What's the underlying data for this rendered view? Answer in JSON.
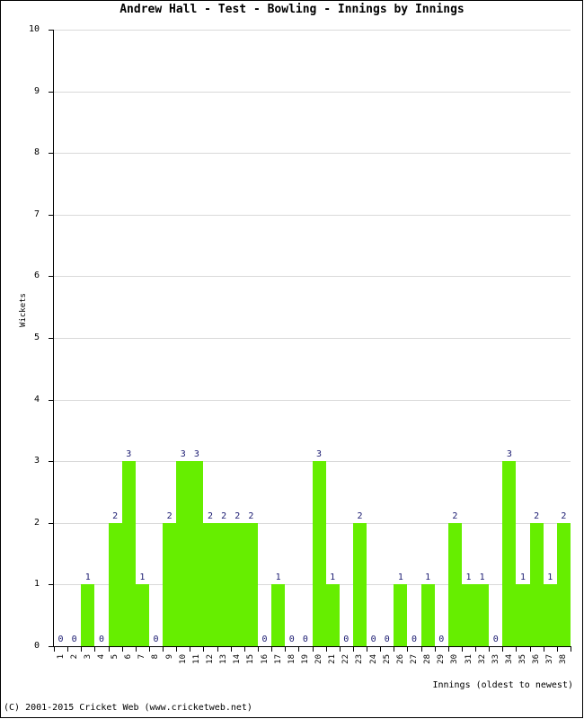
{
  "chart_data": {
    "type": "bar",
    "title": "Andrew Hall - Test - Bowling - Innings by Innings",
    "xlabel": "Innings (oldest to newest)",
    "ylabel": "Wickets",
    "ylim": [
      0,
      10
    ],
    "yticks": [
      0,
      1,
      2,
      3,
      4,
      5,
      6,
      7,
      8,
      9,
      10
    ],
    "grid": true,
    "legend": "none",
    "bar_color": "#66ee00",
    "label_color": "#191970",
    "categories": [
      "1",
      "2",
      "3",
      "4",
      "5",
      "6",
      "7",
      "8",
      "9",
      "10",
      "11",
      "12",
      "13",
      "14",
      "15",
      "16",
      "17",
      "18",
      "19",
      "20",
      "21",
      "22",
      "23",
      "24",
      "25",
      "26",
      "27",
      "28",
      "29",
      "30",
      "31",
      "32",
      "33",
      "34",
      "35",
      "36",
      "37",
      "38"
    ],
    "values": [
      0,
      0,
      1,
      0,
      2,
      3,
      1,
      0,
      2,
      3,
      3,
      2,
      2,
      2,
      2,
      0,
      1,
      0,
      0,
      3,
      1,
      0,
      2,
      0,
      0,
      1,
      0,
      1,
      0,
      2,
      1,
      1,
      0,
      3,
      1,
      2,
      1,
      2
    ],
    "data_labels": [
      "0",
      "0",
      "1",
      "0",
      "2",
      "3",
      "1",
      "0",
      "2",
      "3",
      "3",
      "2",
      "2",
      "2",
      "2",
      "0",
      "1",
      "0",
      "0",
      "3",
      "1",
      "0",
      "2",
      "0",
      "0",
      "1",
      "0",
      "1",
      "0",
      "2",
      "1",
      "1",
      "0",
      "3",
      "1",
      "2",
      "1",
      "2"
    ]
  },
  "footer": {
    "copyright": "(C) 2001-2015 Cricket Web (www.cricketweb.net)"
  }
}
